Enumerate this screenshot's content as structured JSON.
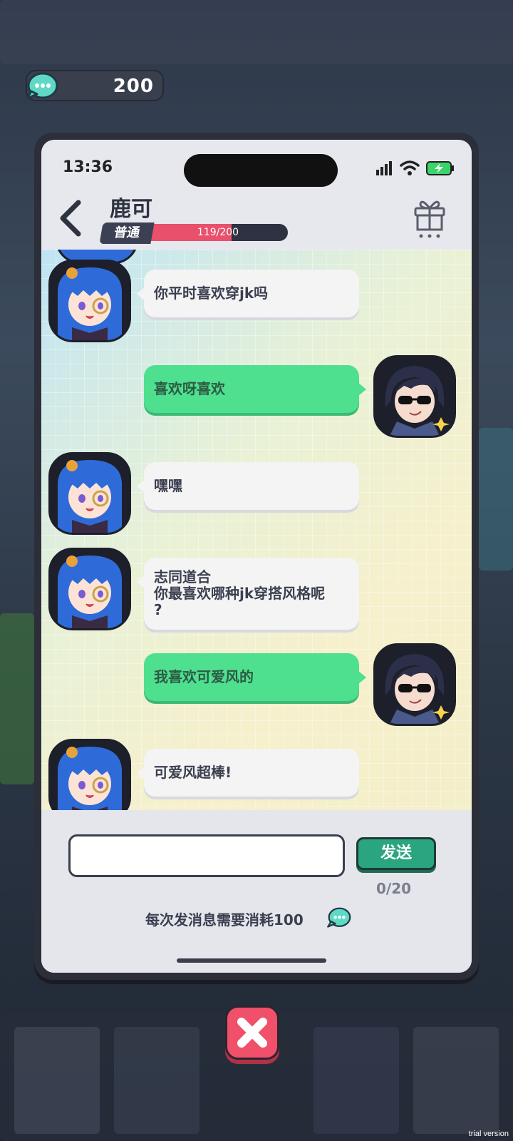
{
  "currency": {
    "amount": "200",
    "icon": "chat-coin-icon"
  },
  "phone": {
    "status_bar": {
      "time": "13:36"
    },
    "header": {
      "contact_name": "鹿可",
      "level_label": "普通",
      "progress_text": "119/200",
      "progress_current": 119,
      "progress_max": 200
    },
    "messages": [
      {
        "side": "in",
        "text": "你平时喜欢穿jk吗"
      },
      {
        "side": "out",
        "text": "喜欢呀喜欢"
      },
      {
        "side": "in",
        "text": "嘿嘿"
      },
      {
        "side": "in",
        "text": "志同道合\n你最喜欢哪种jk穿搭风格呢\n?"
      },
      {
        "side": "out",
        "text": "我喜欢可爱风的"
      },
      {
        "side": "in",
        "text": "可爱风超棒!"
      }
    ],
    "input": {
      "value": "",
      "placeholder": ""
    },
    "send_label": "发送",
    "counter": "0/20",
    "cost_note": "每次发消息需要消耗100"
  },
  "watermark": "trial version",
  "colors": {
    "accent_green": "#4ee08e",
    "send_button": "#2aa57f",
    "level_fill": "#e8506b",
    "close_button": "#f0506a"
  }
}
